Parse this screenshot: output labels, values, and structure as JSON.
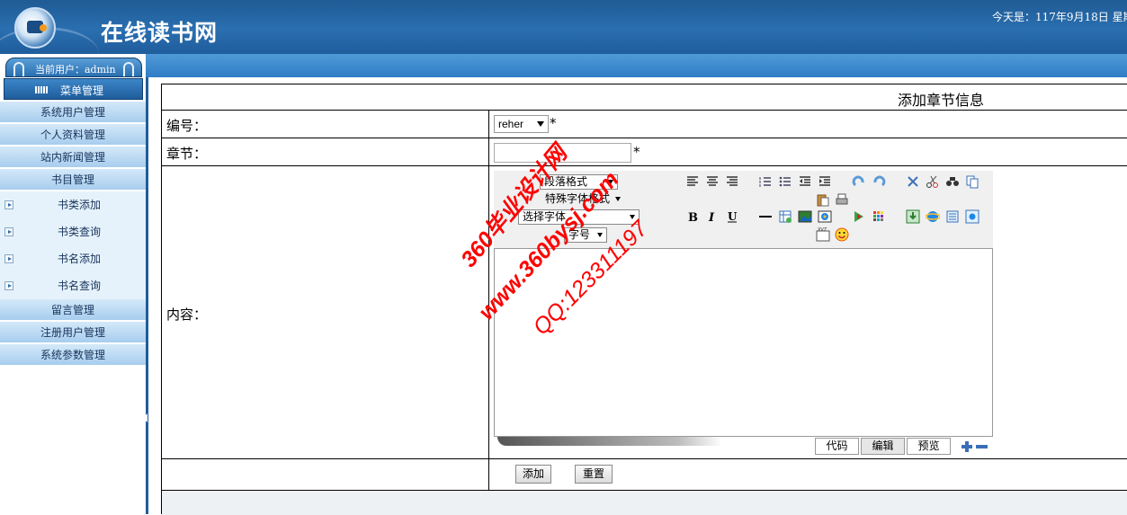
{
  "header": {
    "site_title": "在线读书网",
    "date_text": "今天是：117年9月18日  星期"
  },
  "sidebar": {
    "current_user": "当前用户：admin",
    "menu_head": "菜单管理",
    "items": [
      {
        "label": "系统用户管理"
      },
      {
        "label": "个人资料管理"
      },
      {
        "label": "站内新闻管理"
      },
      {
        "label": "书目管理"
      }
    ],
    "sub_items": [
      {
        "label": "书类添加"
      },
      {
        "label": "书类查询"
      },
      {
        "label": "书名添加"
      },
      {
        "label": "书名查询"
      }
    ],
    "items_after": [
      {
        "label": "留言管理"
      },
      {
        "label": "注册用户管理"
      },
      {
        "label": "系统参数管理"
      }
    ]
  },
  "form": {
    "title": "添加章节信息",
    "id_label": "编号：",
    "id_value": "reher",
    "chapter_label": "章节：",
    "chapter_value": "",
    "content_label": "内容：",
    "required_mark": "*",
    "editor": {
      "dropdowns": [
        "段落格式",
        "特殊字体格式",
        "选择字体",
        "字号"
      ],
      "tabs": [
        "代码",
        "编辑",
        "预览"
      ]
    },
    "submit_label": "添加",
    "reset_label": "重置"
  },
  "watermark": {
    "line1": "360毕业设计网",
    "line2": "www.360bysj.com",
    "line3": "QQ:123311197"
  },
  "colors": {
    "header_blue": "#2a6fb0",
    "menu_light": "#a7cdee",
    "watermark_red": "#ff0000"
  }
}
